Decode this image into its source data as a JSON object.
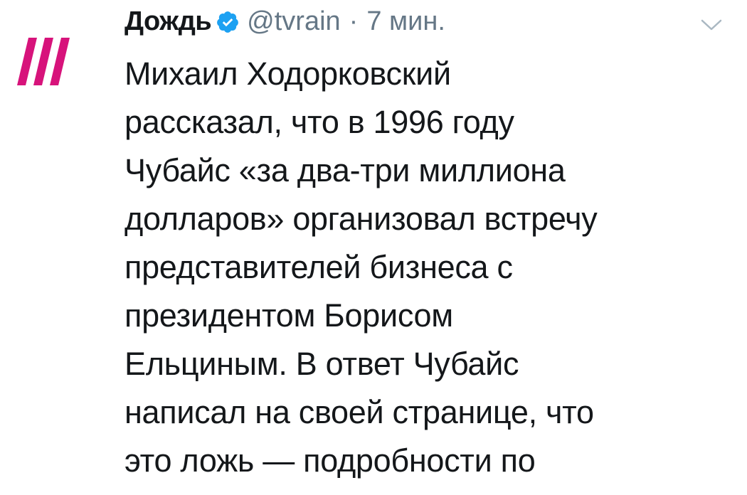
{
  "tweet": {
    "author": {
      "display_name": "Дождь",
      "handle": "@tvrain",
      "verified": true
    },
    "separator": "·",
    "timestamp": "7 мин.",
    "text_lines": [
      "Михаил Ходорковский",
      "рассказал, что в 1996 году",
      "Чубайс «за два-три миллиона",
      "долларов» организовал встречу",
      "представителей бизнеса с",
      "президентом Борисом",
      "Ельциным. В ответ Чубайс",
      "написал на своей странице, что",
      "это ложь — подробности по"
    ]
  },
  "icons": {
    "avatar": "tvrain-logo",
    "verified": "verified-badge-icon",
    "menu": "chevron-down-icon"
  },
  "colors": {
    "logo_magenta": "#d7137b",
    "verified_blue": "#1da1f2",
    "name_text": "#14171a",
    "muted_text": "#657786",
    "caret": "#aab8c2"
  }
}
